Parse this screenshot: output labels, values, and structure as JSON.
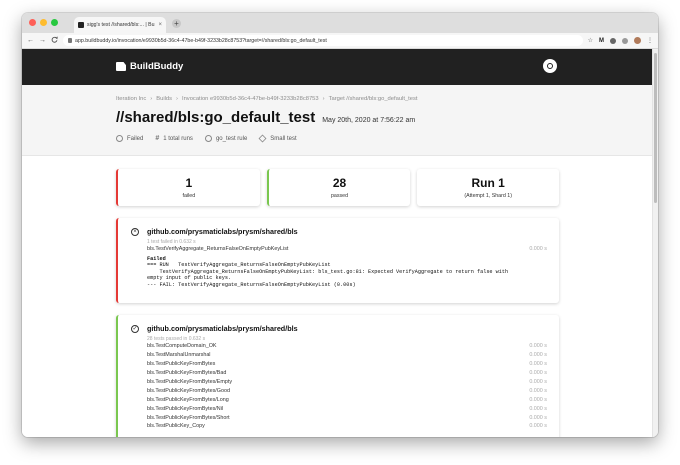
{
  "browser": {
    "tab_title": "sigg's test //shared/bls:... | Bu...",
    "tab_close": "×",
    "new_tab": "+",
    "url": "app.buildbuddy.io/invocation/e9930b5d-36c4-47be-b49f-3233b28c8753?target=//shared/bls:go_default_test",
    "back": "←",
    "forward": "→",
    "reload": "C",
    "star": "☆",
    "ext_m": "M",
    "menu": "⋮",
    "traffic_colors": [
      "#fe5f57",
      "#febc2e",
      "#28c840"
    ]
  },
  "app": {
    "logo": "BuildBuddy"
  },
  "breadcrumb": [
    "Iteration Inc",
    "›",
    "Builds",
    "›",
    "Invocation e9930b5d-36c4-47be-b49f-3233b28c8753",
    "›",
    "Target //shared/bls:go_default_test"
  ],
  "title": "//shared/bls:go_default_test",
  "subtitle": "May 20th, 2020 at 7:56:22 am",
  "meta": {
    "status": "Failed",
    "runs": "1 total runs",
    "rule": "go_test rule",
    "size": "Small test"
  },
  "cards": [
    {
      "big": "1",
      "small": "failed"
    },
    {
      "big": "28",
      "small": "passed"
    },
    {
      "big": "Run 1",
      "small": "(Attempt 1, Shard 1)"
    }
  ],
  "failed_panel": {
    "name": "github.com/prysmaticlabs/prysm/shared/bls",
    "summary": "1 test failed in 0.632 s",
    "test": "bls.TestVerifyAggregate_ReturnsFalseOnEmptyPubKeyList",
    "duration": "0.000 s",
    "log_title": "Failed",
    "log_lines": [
      "=== RUN   TestVerifyAggregate_ReturnsFalseOnEmptyPubKeyList",
      "    TestVerifyAggregate_ReturnsFalseOnEmptyPubKeyList: bls_test.go:81: Expected VerifyAggregate to return false with",
      "empty input of public keys.",
      "--- FAIL: TestVerifyAggregate_ReturnsFalseOnEmptyPubKeyList (0.00s)"
    ]
  },
  "passed_panel": {
    "name": "github.com/prysmaticlabs/prysm/shared/bls",
    "summary": "28 tests passed in 0.632 s",
    "tests": [
      {
        "name": "bls.TestComputeDomain_OK",
        "duration": "0.000 s"
      },
      {
        "name": "bls.TestMarshalUnmarshal",
        "duration": "0.000 s"
      },
      {
        "name": "bls.TestPublicKeyFromBytes",
        "duration": "0.000 s"
      },
      {
        "name": "bls.TestPublicKeyFromBytes/Bad",
        "duration": "0.000 s"
      },
      {
        "name": "bls.TestPublicKeyFromBytes/Empty",
        "duration": "0.000 s"
      },
      {
        "name": "bls.TestPublicKeyFromBytes/Good",
        "duration": "0.000 s"
      },
      {
        "name": "bls.TestPublicKeyFromBytes/Long",
        "duration": "0.000 s"
      },
      {
        "name": "bls.TestPublicKeyFromBytes/Nil",
        "duration": "0.000 s"
      },
      {
        "name": "bls.TestPublicKeyFromBytes/Short",
        "duration": "0.000 s"
      },
      {
        "name": "bls.TestPublicKey_Copy",
        "duration": "0.000 s"
      }
    ]
  }
}
